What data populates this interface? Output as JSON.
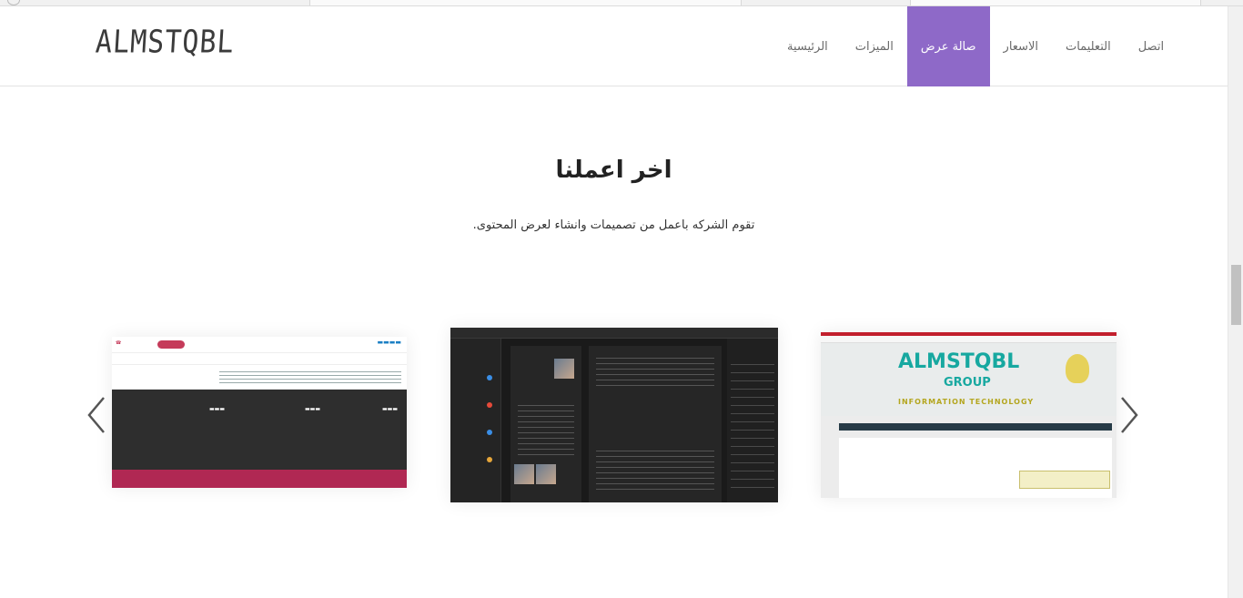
{
  "header": {
    "logo": "ALMSTQBL",
    "nav": [
      {
        "label": "اتصل",
        "active": false
      },
      {
        "label": "التعليمات",
        "active": false
      },
      {
        "label": "الاسعار",
        "active": false
      },
      {
        "label": "صالة عرض",
        "active": true
      },
      {
        "label": "الميزات",
        "active": false
      },
      {
        "label": "الرئيسية",
        "active": false
      }
    ]
  },
  "section": {
    "title": "اخر اعملنا",
    "subtitle": ".تقوم الشركه باعمل من تصميمات وانشاء لعرض المحتوى"
  },
  "carousel": {
    "slides": [
      {
        "name": "school-website-screenshot"
      },
      {
        "name": "dark-social-app-screenshot"
      },
      {
        "name": "almstqbl-group-website-screenshot"
      }
    ],
    "slide3_text": {
      "logo_line1": "ALMSTQBL",
      "logo_line2": "GROUP",
      "logo_line3": "INFORMATION TECHNOLOGY"
    }
  },
  "colors": {
    "accent": "#8e69c8",
    "nav_text": "#6a6a6a",
    "title": "#222222"
  }
}
